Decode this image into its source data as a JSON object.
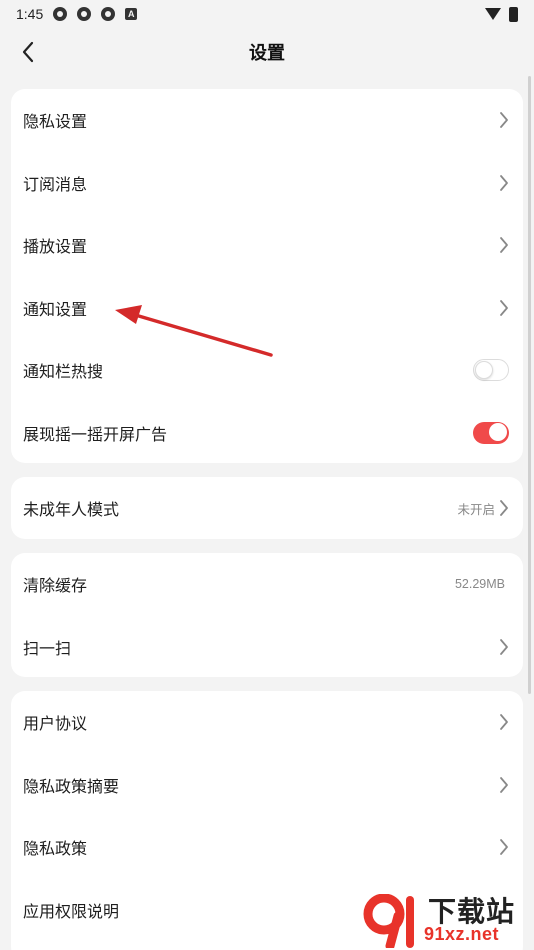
{
  "status_bar": {
    "time": "1:45",
    "notification_icons": [
      "app-notification-icon",
      "app-notification-icon",
      "app-notification-icon"
    ],
    "a_badge": "A",
    "right_icons": [
      "wifi-icon",
      "battery-icon"
    ]
  },
  "header": {
    "title": "设置",
    "back_icon": "chevron-left-icon"
  },
  "section1": {
    "items": [
      {
        "label": "隐私设置",
        "control": "chevron"
      },
      {
        "label": "订阅消息",
        "control": "chevron"
      },
      {
        "label": "播放设置",
        "control": "chevron"
      },
      {
        "label": "通知设置",
        "control": "chevron"
      },
      {
        "label": "通知栏热搜",
        "control": "toggle",
        "state": "off"
      },
      {
        "label": "展现摇一摇开屏广告",
        "control": "toggle",
        "state": "on"
      }
    ]
  },
  "section2": {
    "items": [
      {
        "label": "未成年人模式",
        "value": "未开启",
        "control": "chevron"
      }
    ]
  },
  "section3": {
    "items": [
      {
        "label": "清除缓存",
        "value": "52.29MB"
      },
      {
        "label": "扫一扫",
        "control": "chevron"
      }
    ]
  },
  "section4": {
    "items": [
      {
        "label": "用户协议",
        "control": "chevron"
      },
      {
        "label": "隐私政策摘要",
        "control": "chevron"
      },
      {
        "label": "隐私政策",
        "control": "chevron"
      },
      {
        "label": "应用权限说明",
        "control": "chevron"
      }
    ]
  },
  "watermark": {
    "line1": "下载站",
    "line2": "91xz.net"
  },
  "colors": {
    "background": "#f3f3f3",
    "card": "#ffffff",
    "toggle_on": "#f04a4a",
    "annotation_arrow": "#d42a2a",
    "watermark_red": "#e8332a"
  }
}
